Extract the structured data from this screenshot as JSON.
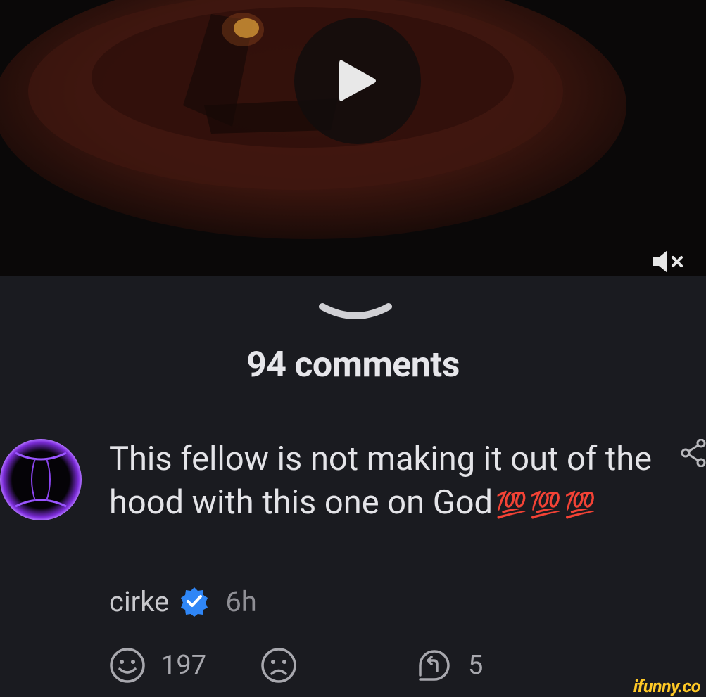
{
  "video": {
    "muted": true
  },
  "comments": {
    "count_label": "94 comments"
  },
  "comment": {
    "text": "This fellow is not making it out of the hood with this one on God",
    "emoji": [
      "💯",
      "💯",
      "💯"
    ],
    "username": "cirke",
    "verified": true,
    "time": "6h",
    "smile_count": "197",
    "reply_count": "5"
  },
  "branding": {
    "logo": "ifunny.co"
  },
  "colors": {
    "background": "#1a1b20",
    "verified_badge": "#2f86f6",
    "avatar_glow": "#8a3cff",
    "logo": "#ffc926",
    "hundred": "#e8234f"
  },
  "icons": [
    "play-icon",
    "mute-icon",
    "chevron-down-icon",
    "share-icon",
    "verified-icon",
    "smile-icon",
    "frown-icon",
    "reply-icon"
  ]
}
